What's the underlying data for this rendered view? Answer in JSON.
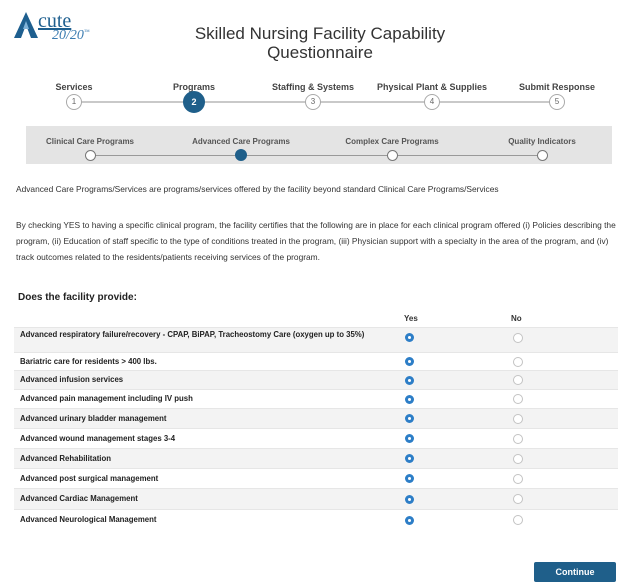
{
  "logo": {
    "word": "cute",
    "subword": "20/20",
    "trademark": "™"
  },
  "title": "Skilled Nursing Facility Capability Questionnaire",
  "steps": [
    {
      "label": "Services",
      "number": "1",
      "active": false
    },
    {
      "label": "Programs",
      "number": "2",
      "active": true
    },
    {
      "label": "Staffing & Systems",
      "number": "3",
      "active": false
    },
    {
      "label": "Physical Plant & Supplies",
      "number": "4",
      "active": false
    },
    {
      "label": "Submit Response",
      "number": "5",
      "active": false
    }
  ],
  "substeps": [
    {
      "label": "Clinical Care Programs",
      "active": false
    },
    {
      "label": "Advanced Care Programs",
      "active": true
    },
    {
      "label": "Complex Care Programs",
      "active": false
    },
    {
      "label": "Quality Indicators",
      "active": false
    }
  ],
  "intro": "Advanced Care Programs/Services are programs/services offered by the facility beyond standard Clinical Care Programs/Services",
  "certification": "By checking YES to having a specific clinical program, the facility certifies that the following are in place for each clinical program offered (i) Policies describing the program, (ii) Education of staff specific to the type of conditions treated in the program, (iii) Physician support with a specialty in the area of the program, and (iv) track outcomes related to the residents/patients receiving services of the program.",
  "question": "Does the facility provide:",
  "columns": {
    "yes": "Yes",
    "no": "No"
  },
  "items": [
    {
      "label": "Advanced respiratory failure/recovery - CPAP, BiPAP, Tracheostomy Care (oxygen up to 35%)",
      "answer": "Yes"
    },
    {
      "label": "Bariatric care for residents > 400 lbs.",
      "answer": "Yes"
    },
    {
      "label": "Advanced infusion services",
      "answer": "Yes"
    },
    {
      "label": "Advanced pain management including IV push",
      "answer": "Yes"
    },
    {
      "label": "Advanced urinary bladder management",
      "answer": "Yes"
    },
    {
      "label": "Advanced wound management stages 3-4",
      "answer": "Yes"
    },
    {
      "label": "Advanced Rehabilitation",
      "answer": "Yes"
    },
    {
      "label": "Advanced post surgical management",
      "answer": "Yes"
    },
    {
      "label": "Advanced Cardiac Management",
      "answer": "Yes"
    },
    {
      "label": "Advanced Neurological Management",
      "answer": "Yes"
    }
  ],
  "continue_label": "Continue",
  "colors": {
    "primary": "#1f5f8a",
    "radio_selected": "#2d7ec7"
  }
}
